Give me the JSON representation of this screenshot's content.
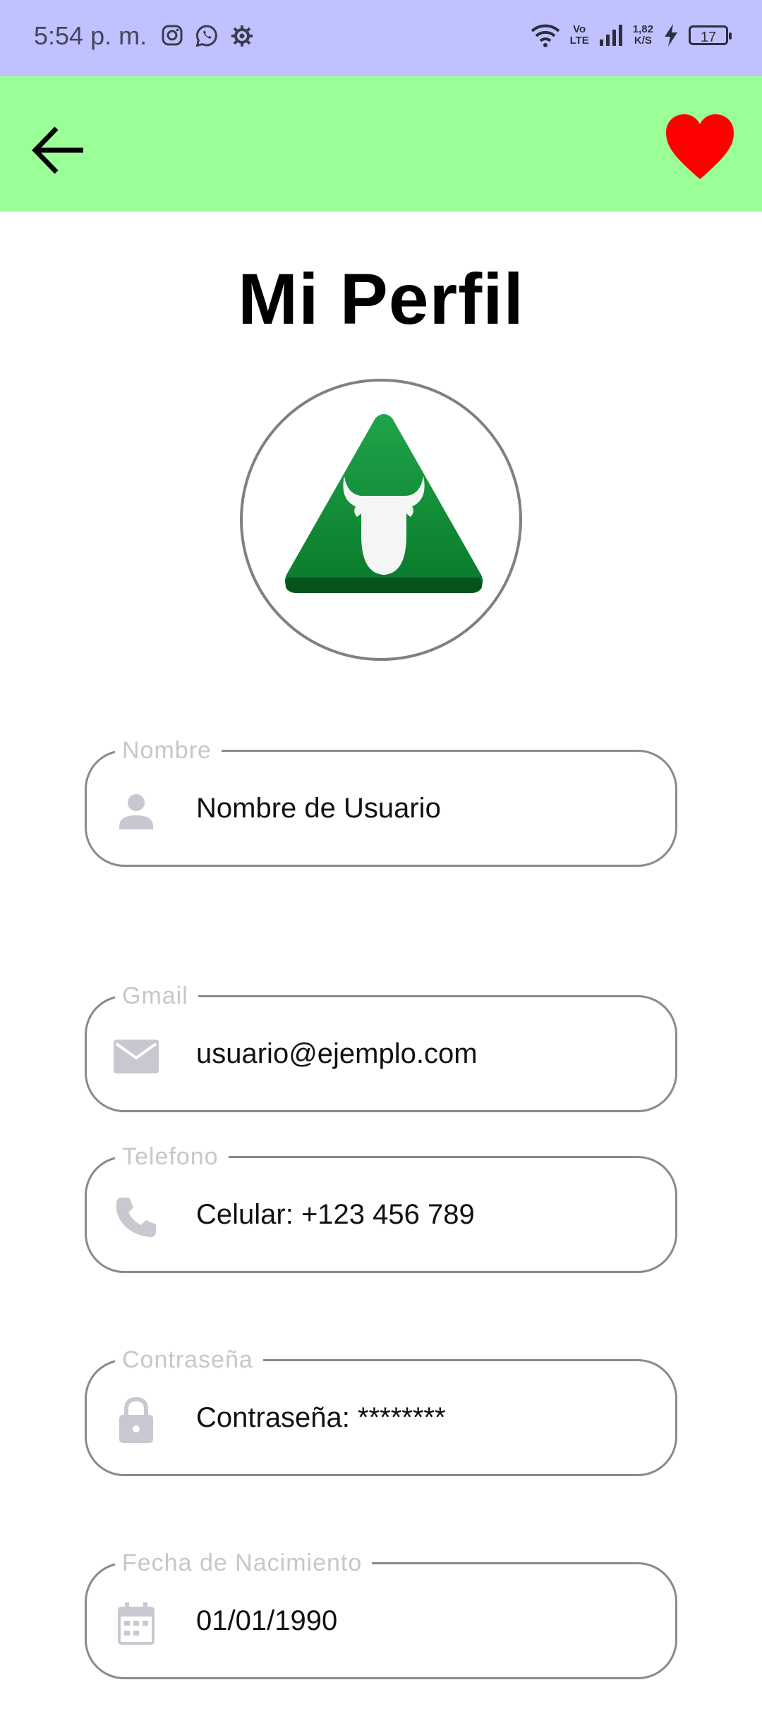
{
  "status_bar": {
    "time": "5:54 p. m.",
    "volte_top": "Vo",
    "volte_bottom": "LTE",
    "speed_value": "1,82",
    "speed_unit": "K/S",
    "battery": "17"
  },
  "app_bar": {
    "back_icon": "arrow-back-icon",
    "favorite_icon": "heart-icon",
    "accent_color": "#9bff97",
    "heart_color": "#ff0000"
  },
  "page": {
    "title": "Mi Perfil"
  },
  "profile": {
    "avatar_icon": "bull-logo-icon",
    "fields": [
      {
        "label": "Nombre",
        "value": "Nombre de Usuario",
        "icon": "person-icon"
      },
      {
        "label": "Gmail",
        "value": "usuario@ejemplo.com",
        "icon": "mail-icon"
      },
      {
        "label": "Telefono",
        "value": "Celular: +123 456 789",
        "icon": "phone-icon"
      },
      {
        "label": "Contraseña",
        "value": "Contraseña: ********",
        "icon": "lock-icon"
      },
      {
        "label": "Fecha de Nacimiento",
        "value": "01/01/1990",
        "icon": "calendar-icon"
      }
    ]
  }
}
